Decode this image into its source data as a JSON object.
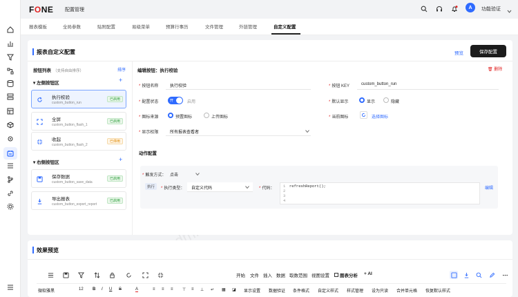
{
  "app": {
    "logo_a": "F",
    "logo_o": "O",
    "logo_b": "NE",
    "title": "配置管理",
    "notification_count": "",
    "avatar_letter": "A",
    "user_name": "功能验证"
  },
  "tabs": [
    {
      "label": "报表模板",
      "active": false
    },
    {
      "label": "全局参数",
      "active": false
    },
    {
      "label": "贴附配置",
      "active": false
    },
    {
      "label": "易级菜单",
      "active": false
    },
    {
      "label": "预算行事历",
      "active": false
    },
    {
      "label": "文件管理",
      "active": false
    },
    {
      "label": "外链管理",
      "active": false
    },
    {
      "label": "自定义配置",
      "active": true
    }
  ],
  "page": {
    "title": "报表自定义配置",
    "preview_link": "预览",
    "save_button": "保存配置"
  },
  "left_panel": {
    "title": "按钮列表",
    "hint": "（支持自由排序）",
    "sort_link": "排序",
    "left_group": {
      "label": "左侧按钮区",
      "add": "+",
      "items": [
        {
          "name": "执行校验",
          "code": "custom_button_run",
          "status": "已启用",
          "status_type": "on",
          "icon": "refresh-icon"
        },
        {
          "name": "全屏",
          "code": "custom_button_flash_1",
          "status": "已启用",
          "status_type": "on",
          "icon": "fullscreen-icon"
        },
        {
          "name": "收起",
          "code": "custom_button_flash_2",
          "status": "已停用",
          "status_type": "off",
          "icon": "collapse-icon"
        }
      ]
    },
    "right_group": {
      "label": "右侧按钮区",
      "add": "+",
      "items": [
        {
          "name": "保存数据",
          "code": "custom_button_save_data",
          "status": "已启用",
          "status_type": "on",
          "icon": "save-icon"
        },
        {
          "name": "导出报表",
          "code": "custom_button_export_report",
          "status": "已启用",
          "status_type": "on",
          "icon": "export-icon"
        }
      ]
    }
  },
  "editor": {
    "title": "编辑按钮：执行校验",
    "delete": "删除",
    "fields": {
      "name_label": "按钮名称",
      "name_value": "执行校验",
      "key_label": "按钮 KEY",
      "key_value": "custom_button_run",
      "state_label": "配置状态",
      "toggle_on": "开",
      "state_text": "启用",
      "default_label": "默认显示",
      "default_show": "显示",
      "default_hide": "隐藏",
      "icon_source_label": "图标来源",
      "icon_preset": "预置图标",
      "icon_upload": "上传图标",
      "current_icon_label": "当前图标",
      "choose_icon": "选择图标",
      "perm_label": "显示权限",
      "perm_value": "所有报表查看者"
    },
    "actions": {
      "title": "动作配置",
      "trigger_label": "触发方式：",
      "trigger_value": "点击",
      "exec_tag": "执行",
      "exec_type_label": "执行类型：",
      "exec_type_value": "自定义代码",
      "code_label": "代码：",
      "code_lines": [
        "1",
        "2",
        "3",
        "4"
      ],
      "code_text": "refreshReport();",
      "edit_link": "编辑"
    }
  },
  "preview": {
    "title": "效果预览",
    "menus": [
      "开始",
      "文件",
      "插入",
      "数据",
      "取数范围",
      "视图设置",
      "图表分析",
      "+ AI"
    ],
    "font_name": "微软雅黑",
    "font_size": "12",
    "format_items": [
      "显示设置",
      "数据验证",
      "条件格式",
      "自定义样式",
      "样式管理",
      "设为只读",
      "合并单元格",
      "恢复默认样式"
    ]
  },
  "watermark": "admin",
  "colors": {
    "accent": "#2f6bff",
    "enabled": "#2a9d3a",
    "disabled": "#e08a00",
    "danger": "#e02020",
    "dark_button": "#1c1c1c"
  }
}
